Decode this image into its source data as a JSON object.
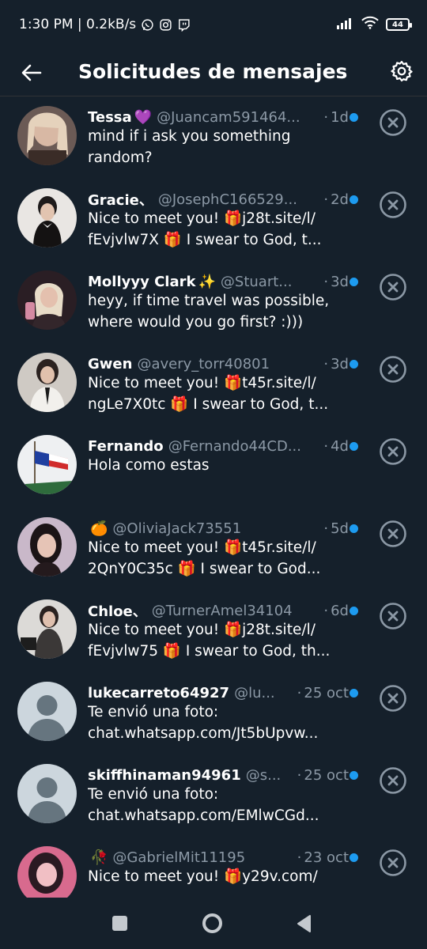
{
  "status_bar": {
    "time_speed": "1:30 PM | 0.2kB/s",
    "icons": [
      "whatsapp-icon",
      "instagram-icon",
      "twitch-icon",
      "signal-icon",
      "wifi-icon",
      "battery-icon"
    ],
    "battery": "44"
  },
  "header": {
    "title": "Solicitudes de mensajes",
    "back_icon": "arrow-left-icon",
    "settings_icon": "gear-icon"
  },
  "colors": {
    "background": "#15202b",
    "accent": "#1d9bf0",
    "muted": "#8b98a5",
    "text": "#ffffff"
  },
  "requests": [
    {
      "name": "Tessa",
      "name_emoji": "💜",
      "handle": "@Juancam591464...",
      "age": "1d",
      "preview": [
        "mind if i ask you something",
        "random?"
      ]
    },
    {
      "name": "Gracie、",
      "name_emoji": "",
      "handle": "@JosephC166529...",
      "age": "2d",
      "preview": [
        "Nice to meet you! 🎁j28t.site/l/",
        "fEvjvlw7X 🎁 I swear to God, t..."
      ]
    },
    {
      "name": "Mollyyy Clark",
      "name_emoji": "✨",
      "handle": "@Stuart...",
      "age": "3d",
      "preview": [
        "heyy, if time travel was possible,",
        "where would you go first? :)))"
      ]
    },
    {
      "name": "Gwen",
      "name_emoji": "",
      "handle": "@avery_torr40801",
      "age": "3d",
      "preview": [
        "Nice to meet you! 🎁t45r.site/l/",
        "ngLe7X0tc 🎁 I swear to God, t..."
      ]
    },
    {
      "name": "Fernando",
      "name_emoji": "",
      "handle": "@Fernando44CD...",
      "age": "4d",
      "preview": [
        "Hola como estas"
      ]
    },
    {
      "name": "",
      "name_emoji": "🍊",
      "handle": "@OliviaJack73551",
      "age": "5d",
      "preview": [
        "Nice to meet you! 🎁t45r.site/l/",
        "2QnY0C35c 🎁 I swear to God..."
      ]
    },
    {
      "name": "Chloe、",
      "name_emoji": "",
      "handle": "@TurnerAmel34104",
      "age": "6d",
      "preview": [
        "Nice to meet you! 🎁j28t.site/l/",
        "fEvjvlw75 🎁 I swear to God, th..."
      ]
    },
    {
      "name": "lukecarreto64927",
      "name_emoji": "",
      "handle": "@lu...",
      "age": "25 oct",
      "preview": [
        "Te envió una foto:",
        "chat.whatsapp.com/Jt5bUpvw..."
      ]
    },
    {
      "name": "skiffhinaman94961",
      "name_emoji": "",
      "handle": "@s...",
      "age": "25 oct",
      "preview": [
        "Te envió una foto:",
        "chat.whatsapp.com/EMlwCGd..."
      ]
    },
    {
      "name": "",
      "name_emoji": "🥀",
      "handle": "@GabrielMit11195",
      "age": "23 oct",
      "preview": [
        "Nice to meet you! 🎁y29v.com/"
      ]
    }
  ],
  "navbar": {
    "icons": [
      "recents-square-icon",
      "home-circle-icon",
      "back-triangle-icon"
    ]
  }
}
